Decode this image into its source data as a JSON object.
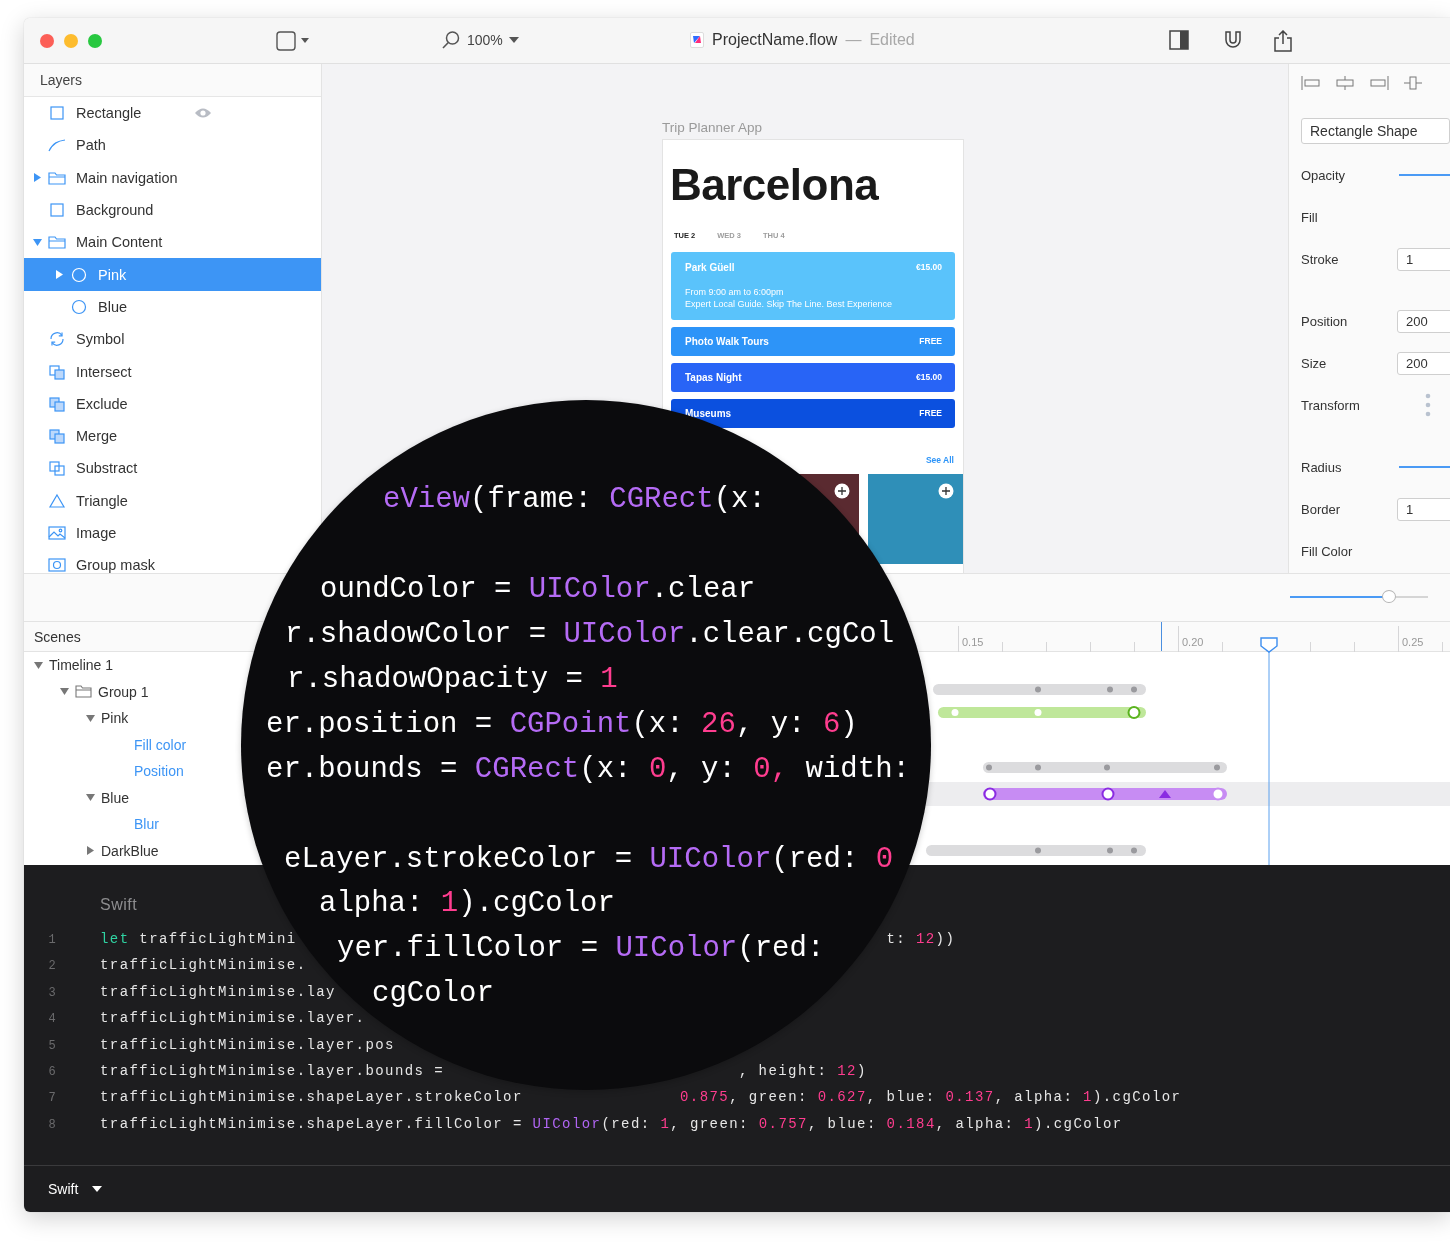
{
  "toolbar": {
    "zoom": "100%",
    "document": {
      "name": "ProjectName.flow",
      "separator": "—",
      "status": "Edited"
    }
  },
  "layers": {
    "title": "Layers",
    "items": [
      {
        "label": "Rectangle",
        "kind": "rectangle",
        "selected": false,
        "eye": true
      },
      {
        "label": "Path",
        "kind": "path",
        "selected": false
      },
      {
        "label": "Main navigation",
        "kind": "folder",
        "selected": false,
        "expanded": false
      },
      {
        "label": "Background",
        "kind": "rectangle",
        "selected": false
      },
      {
        "label": "Main Content",
        "kind": "folder",
        "selected": false,
        "expanded": true,
        "children": [
          {
            "label": "Pink",
            "kind": "circle",
            "selected": true,
            "expanded": false
          },
          {
            "label": "Blue",
            "kind": "circle",
            "selected": false
          }
        ]
      },
      {
        "label": "Symbol",
        "kind": "symbol",
        "selected": false
      },
      {
        "label": "Intersect",
        "kind": "intersect",
        "selected": false
      },
      {
        "label": "Exclude",
        "kind": "exclude",
        "selected": false
      },
      {
        "label": "Merge",
        "kind": "merge",
        "selected": false
      },
      {
        "label": "Substract",
        "kind": "substract",
        "selected": false
      },
      {
        "label": "Triangle",
        "kind": "triangle",
        "selected": false
      },
      {
        "label": "Image",
        "kind": "image",
        "selected": false
      },
      {
        "label": "Group mask",
        "kind": "mask",
        "selected": false
      }
    ]
  },
  "canvas": {
    "artboard_label": "Trip Planner App",
    "artboard": {
      "title": "Barcelona",
      "tabs": [
        {
          "label": "TUE 2",
          "selected": true
        },
        {
          "label": "WED 3",
          "selected": false
        },
        {
          "label": "THU 4",
          "selected": false
        }
      ],
      "activities": [
        {
          "title": "Park Güell",
          "price": "€15.00",
          "color": "#5ac3fb",
          "details": [
            "From 9:00 am to 6:00pm",
            "Expert Local Guide. Skip The Line. Best Experience"
          ]
        },
        {
          "title": "Photo Walk Tours",
          "price": "FREE",
          "color": "#2d94f8"
        },
        {
          "title": "Tapas Night",
          "price": "€15.00",
          "color": "#2864f6"
        },
        {
          "title": "Museums",
          "price": "FREE",
          "color": "#0b50df"
        }
      ],
      "see_all": "See All"
    }
  },
  "inspector": {
    "shape_name": "Rectangle Shape",
    "sections": [
      {
        "rows": [
          {
            "label": "Opacity",
            "kind": "slider"
          },
          {
            "label": "Fill",
            "kind": "plain"
          },
          {
            "label": "Stroke",
            "kind": "field",
            "value": "1"
          }
        ]
      },
      {
        "rows": [
          {
            "label": "Position",
            "kind": "field",
            "value": "200"
          },
          {
            "label": "Size",
            "kind": "field",
            "value": "200"
          },
          {
            "label": "Transform",
            "kind": "menu"
          }
        ]
      },
      {
        "rows": [
          {
            "label": "Radius",
            "kind": "slider"
          },
          {
            "label": "Border",
            "kind": "field",
            "value": "1"
          },
          {
            "label": "Fill Color",
            "kind": "plain"
          }
        ]
      }
    ]
  },
  "timeline": {
    "zoom_slider": {
      "level": 0.72
    },
    "scenes_title": "Scenes",
    "ruler": [
      "0.15",
      "0.20",
      "0.25"
    ],
    "tree": [
      {
        "label": "Timeline 1",
        "expanded": true,
        "children": [
          {
            "label": "Group 1",
            "kind": "group",
            "expanded": true,
            "children": [
              {
                "label": "Pink",
                "expanded": true,
                "children": [
                  {
                    "label": "Fill color",
                    "kind": "property"
                  },
                  {
                    "label": "Position",
                    "kind": "property"
                  }
                ]
              },
              {
                "label": "Blue",
                "expanded": true,
                "children": [
                  {
                    "label": "Blur",
                    "kind": "property"
                  }
                ]
              },
              {
                "label": "DarkBlue",
                "expanded": false
              }
            ]
          }
        ]
      }
    ]
  },
  "editor": {
    "language": "Swift",
    "lines": [
      {
        "number": "1",
        "left": [
          {
            "t": "let",
            "kind": "keyword"
          },
          {
            "t": " trafficLightMini",
            "kind": "plain"
          }
        ],
        "right": [
          {
            "t": "t: ",
            "kind": "plain"
          },
          {
            "t": "12",
            "kind": "number"
          },
          {
            "t": "))",
            "kind": "plain"
          }
        ]
      },
      {
        "number": "2",
        "left": [
          {
            "t": "trafficLightMinimise.",
            "kind": "plain"
          }
        ]
      },
      {
        "number": "3",
        "left": [
          {
            "t": "trafficLightMinimise.lay",
            "kind": "plain"
          }
        ]
      },
      {
        "number": "4",
        "left": [
          {
            "t": "trafficLightMinimise.layer.",
            "kind": "plain"
          }
        ]
      },
      {
        "number": "5",
        "left": [
          {
            "t": "trafficLightMinimise.layer.pos",
            "kind": "plain"
          }
        ]
      },
      {
        "number": "6",
        "left": [
          {
            "t": "trafficLightMinimise.layer.bounds =",
            "kind": "plain"
          }
        ],
        "right": [
          {
            "t": ", height: ",
            "kind": "plain"
          },
          {
            "t": "12",
            "kind": "number"
          },
          {
            "t": ")",
            "kind": "plain"
          }
        ]
      },
      {
        "number": "7",
        "left": [
          {
            "t": "trafficLightMinimise.shapeLayer.strokeColor",
            "kind": "plain"
          }
        ],
        "right": [
          {
            "t": "0.875",
            "kind": "number"
          },
          {
            "t": ", green: ",
            "kind": "plain"
          },
          {
            "t": "0.627",
            "kind": "number"
          },
          {
            "t": ", blue: ",
            "kind": "plain"
          },
          {
            "t": "0.137",
            "kind": "number"
          },
          {
            "t": ", alpha: ",
            "kind": "plain"
          },
          {
            "t": "1",
            "kind": "number"
          },
          {
            "t": ").cgColor",
            "kind": "plain"
          }
        ]
      },
      {
        "number": "8",
        "left": [
          {
            "t": "trafficLightMinimise.shapeLayer.fillColor = ",
            "kind": "plain"
          },
          {
            "t": "UIColor",
            "kind": "type"
          },
          {
            "t": "(red: ",
            "kind": "plain"
          },
          {
            "t": "1",
            "kind": "number"
          },
          {
            "t": ", green: ",
            "kind": "plain"
          },
          {
            "t": "0.757",
            "kind": "number"
          },
          {
            "t": ", blue: ",
            "kind": "plain"
          },
          {
            "t": "0.184",
            "kind": "number"
          },
          {
            "t": ", alpha: ",
            "kind": "plain"
          },
          {
            "t": "1",
            "kind": "number"
          },
          {
            "t": ").cgColor",
            "kind": "plain"
          }
        ]
      }
    ]
  },
  "magnifier": {
    "lines": [
      [
        {
          "t": "eView",
          "kind": "type"
        },
        {
          "t": "(frame: ",
          "kind": "plain"
        },
        {
          "t": "CGRect",
          "kind": "type"
        },
        {
          "t": "(x:",
          "kind": "plain"
        }
      ],
      [
        {
          "t": "oundColor = ",
          "kind": "plain"
        },
        {
          "t": "UIColor",
          "kind": "type"
        },
        {
          "t": ".clear",
          "kind": "plain"
        }
      ],
      [
        {
          "t": "r.shadowColor = ",
          "kind": "plain"
        },
        {
          "t": "UIColor",
          "kind": "type"
        },
        {
          "t": ".clear.cgCol",
          "kind": "plain"
        }
      ],
      [
        {
          "t": "r.shadowOpacity = ",
          "kind": "plain"
        },
        {
          "t": "1",
          "kind": "number"
        }
      ],
      [
        {
          "t": "er.position = ",
          "kind": "plain"
        },
        {
          "t": "CGPoint",
          "kind": "type"
        },
        {
          "t": "(x: ",
          "kind": "plain"
        },
        {
          "t": "26",
          "kind": "number"
        },
        {
          "t": ", y: ",
          "kind": "plain"
        },
        {
          "t": "6",
          "kind": "number"
        },
        {
          "t": ")",
          "kind": "plain"
        }
      ],
      [
        {
          "t": "er.bounds = ",
          "kind": "plain"
        },
        {
          "t": "CGRect",
          "kind": "type"
        },
        {
          "t": "(x: ",
          "kind": "plain"
        },
        {
          "t": "0",
          "kind": "number"
        },
        {
          "t": ", y: ",
          "kind": "plain"
        },
        {
          "t": "0,",
          "kind": "number"
        },
        {
          "t": " width:",
          "kind": "plain"
        }
      ],
      [
        {
          "t": "eLayer.strokeColor = ",
          "kind": "plain"
        },
        {
          "t": "UIColor",
          "kind": "type"
        },
        {
          "t": "(red: ",
          "kind": "plain"
        },
        {
          "t": "0",
          "kind": "number"
        }
      ],
      [
        {
          "t": "alpha: ",
          "kind": "plain"
        },
        {
          "t": "1",
          "kind": "number"
        },
        {
          "t": ").cgColor",
          "kind": "plain"
        }
      ],
      [
        {
          "t": "yer.fillColor = ",
          "kind": "plain"
        },
        {
          "t": "UIColor",
          "kind": "type"
        },
        {
          "t": "(red:",
          "kind": "plain"
        }
      ],
      [
        {
          "t": "cgColor",
          "kind": "plain"
        }
      ]
    ]
  },
  "footer": {
    "language": "Swift"
  }
}
